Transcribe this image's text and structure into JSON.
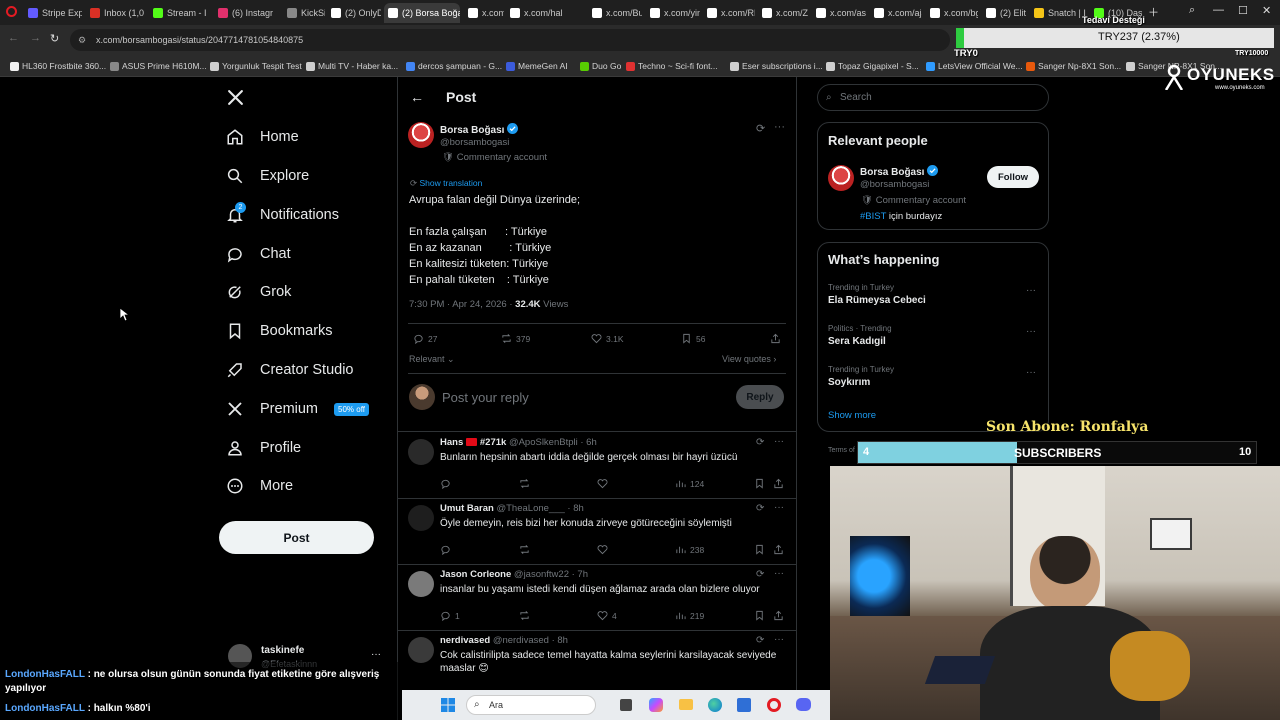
{
  "browser": {
    "tabs": [
      {
        "label": "Stripe Exp",
        "color": "#635bff"
      },
      {
        "label": "Inbox (1,0",
        "color": "#d93025"
      },
      {
        "label": "Stream - I",
        "color": "#53fc18"
      },
      {
        "label": "(6) Instagr",
        "color": "#e1306c"
      },
      {
        "label": "KickSight",
        "color": "#888888"
      },
      {
        "label": "(2) OnlyD",
        "color": "#ffffff"
      },
      {
        "label": "(2) Borsa Boğası",
        "color": "#ffffff"
      },
      {
        "label": "x.com/kal",
        "color": "#ffffff"
      },
      {
        "label": "x.com/hal",
        "color": "#ffffff"
      },
      {
        "label": "x.com/Bu",
        "color": "#ffffff"
      },
      {
        "label": "x.com/yin",
        "color": "#ffffff"
      },
      {
        "label": "x.com/RE",
        "color": "#ffffff"
      },
      {
        "label": "x.com/Zar",
        "color": "#ffffff"
      },
      {
        "label": "x.com/as",
        "color": "#ffffff"
      },
      {
        "label": "x.com/aja",
        "color": "#ffffff"
      },
      {
        "label": "x.com/bg",
        "color": "#ffffff"
      },
      {
        "label": "(2) Elit M",
        "color": "#ffffff"
      },
      {
        "label": "Snatch | I",
        "color": "#f5c518"
      },
      {
        "label": "(10) Dash",
        "color": "#53fc18"
      }
    ],
    "url": "x.com/borsambogasi/status/2047714781054840875",
    "bookmarks": [
      {
        "label": "HL360 Frostbite 360...",
        "color": "#f2f2f2"
      },
      {
        "label": "ASUS Prime H610M...",
        "color": "#888888"
      },
      {
        "label": "Yorgunluk Tespit Test",
        "color": "#cfcfcf"
      },
      {
        "label": "Multi TV - Haber ka...",
        "color": "#cfcfcf"
      },
      {
        "label": "dercos şampuan - G...",
        "color": "#4285f4"
      },
      {
        "label": "MemeGen AI",
        "color": "#3b5bdb"
      },
      {
        "label": "Duo Go",
        "color": "#58cc02"
      },
      {
        "label": "Techno ~ Sci-fi font...",
        "color": "#e03131"
      },
      {
        "label": "Eser subscriptions i...",
        "color": "#cfcfcf"
      },
      {
        "label": "Topaz Gigapixel - S...",
        "color": "#cfcfcf"
      },
      {
        "label": "LetsView Official We...",
        "color": "#2f9bff"
      },
      {
        "label": "Sanger Np-8X1 Son...",
        "color": "#e8590c"
      },
      {
        "label": "Sanger NP-8X1 Son...",
        "color": "#cfcfcf"
      }
    ]
  },
  "nav": {
    "items": [
      {
        "label": "Home",
        "icon": "home-icon"
      },
      {
        "label": "Explore",
        "icon": "search-icon"
      },
      {
        "label": "Notifications",
        "icon": "bell-icon",
        "badge": "2"
      },
      {
        "label": "Chat",
        "icon": "chat-icon"
      },
      {
        "label": "Grok",
        "icon": "grok-icon"
      },
      {
        "label": "Bookmarks",
        "icon": "bookmark-icon"
      },
      {
        "label": "Creator Studio",
        "icon": "rocket-icon"
      },
      {
        "label": "Premium",
        "icon": "x-logo-icon",
        "badge": "50% off"
      },
      {
        "label": "Profile",
        "icon": "person-icon"
      },
      {
        "label": "More",
        "icon": "more-circle-icon"
      }
    ],
    "post_label": "Post",
    "account": {
      "name": "taskinefe",
      "handle": "@Efetaskinnn"
    }
  },
  "post": {
    "header_title": "Post",
    "author": "Borsa Boğası",
    "handle": "@borsambogasi",
    "account_type": "Commentary account",
    "show_translation": "Show translation",
    "lines": [
      "Avrupa falan değil Dünya üzerinde;",
      "En fazla çalışan      : Türkiye",
      "En az kazanan         : Türkiye",
      "En kalitesizi tüketen: Türkiye",
      "En pahalı tüketen    : Türkiye"
    ],
    "time": "7:30 PM · Apr 24, 2026 · ",
    "views_count": "32.4K",
    "views_label": " Views",
    "stats": {
      "replies": "27",
      "reposts": "379",
      "likes": "3.1K",
      "bookmarks": "56"
    },
    "sort": "Relevant",
    "view_quotes": "View quotes",
    "reply_placeholder": "Post your reply",
    "reply_button": "Reply"
  },
  "replies": [
    {
      "name": "Hans",
      "extra": "#271k",
      "handle": "@ApoSlkenBtpli",
      "time": "· 6h",
      "text": "Bunların hepsinin abartı iddia değilde gerçek olması bir hayri üzücü",
      "replies": "",
      "reposts": "",
      "likes": "",
      "views": "124"
    },
    {
      "name": "Umut Baran",
      "extra": "",
      "handle": "@TheaLone___",
      "time": "· 8h",
      "text": "Öyle demeyin, reis bizi her konuda zirveye götüreceğini söylemişti",
      "replies": "",
      "reposts": "",
      "likes": "",
      "views": "238"
    },
    {
      "name": "Jason Corleone",
      "extra": "",
      "handle": "@jasonftw22",
      "time": "· 7h",
      "text": "insanlar bu yaşamı istedi kendi düşen ağlamaz arada olan bizlere oluyor",
      "replies": "1",
      "reposts": "",
      "likes": "4",
      "views": "219"
    },
    {
      "name": "nerdivased",
      "extra": "",
      "handle": "@nerdivased",
      "time": "· 8h",
      "text": "Cok calistirilipta sadece temel hayatta kalma seylerini karsilayacak seviyede maaslar 😊",
      "replies": "",
      "reposts": "",
      "likes": "",
      "views": ""
    }
  ],
  "sidebar": {
    "search_placeholder": "Search",
    "relevant_title": "Relevant people",
    "person": {
      "name": "Borsa Boğası",
      "handle": "@borsambogasi",
      "account_type": "Commentary account",
      "bio_tag": "#BIST",
      "bio_rest": " için burdayız"
    },
    "follow_label": "Follow",
    "happening_title": "What’s happening",
    "trends": [
      {
        "context": "Trending in Turkey",
        "name": "Ela Rümeysa Cebeci"
      },
      {
        "context": "Politics · Trending",
        "name": "Sera Kadıgil"
      },
      {
        "context": "Trending in Turkey",
        "name": "Soykırım"
      }
    ],
    "show_more": "Show more",
    "terms": "Terms of"
  },
  "overlay": {
    "ticker_label": "TRY0",
    "ticker_value": "TRY237 (2.37%)",
    "ticker_small": "TRY10000",
    "tedavi": "Tedavi Desteği",
    "brand": "OYUNEKS",
    "brand_url": "www.oyuneks.com",
    "son_abone": "Son Abone: Ronfalya",
    "sub_current": "4",
    "sub_label": "SUBSCRIBERS",
    "sub_goal": "10",
    "sub_progress": 0.4
  },
  "chat": [
    {
      "user": "LondonHasFALL",
      "message": " : ne olursa olsun günün sonunda fiyat etiketine göre alışveriş yapılıyor"
    },
    {
      "user": "LondonHasFALL",
      "message": " : halkın %80'i"
    }
  ],
  "taskbar": {
    "search_label": "Ara"
  },
  "colors": {
    "accent": "#1d9bf0",
    "background": "#000000",
    "border": "#2f3336",
    "muted": "#71767b"
  }
}
